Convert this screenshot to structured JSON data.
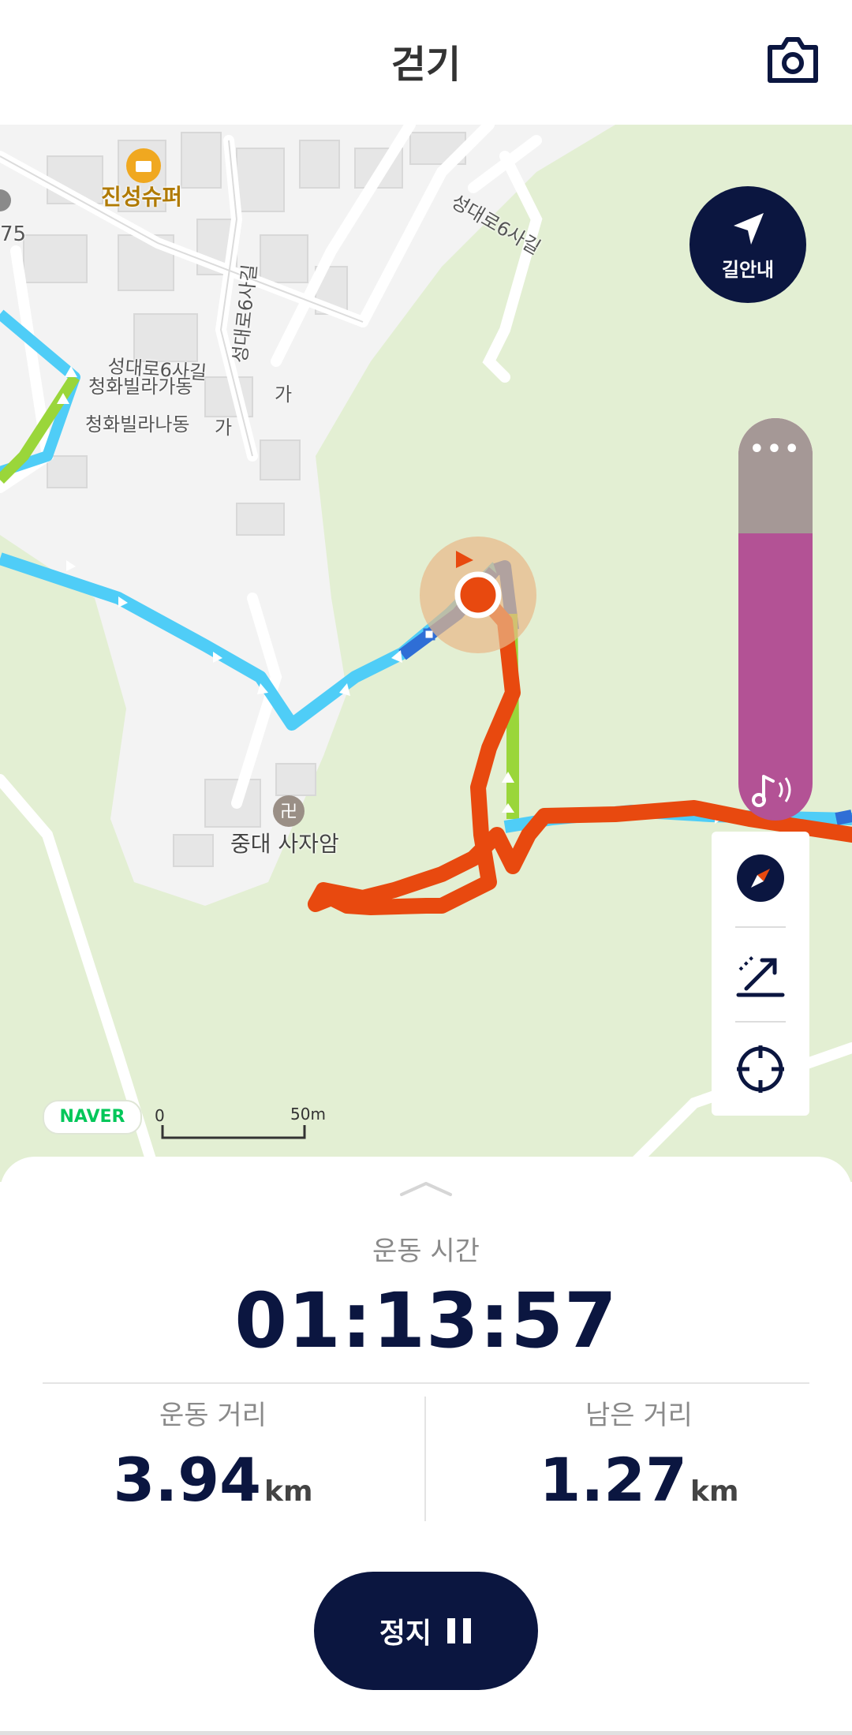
{
  "header": {
    "title": "걷기",
    "camera_icon": "camera-icon"
  },
  "map": {
    "labels": {
      "poi_store": "진성슈퍼",
      "edge_number": "75",
      "road_top": "성대로6사길",
      "road_vertical": "성대로6사길",
      "road_mid": "성대로6사길",
      "villa_ga": "청화빌라가동",
      "villa_na": "청화빌라나동",
      "ga_1": "가",
      "ga_2": "가",
      "temple": "중대 사자암"
    },
    "guide_button": {
      "label": "길안내",
      "icon": "navigation-arrow-icon"
    },
    "more_label": "•••",
    "naver_logo": "NAVER",
    "scale": {
      "zero": "0",
      "fifty": "50m"
    },
    "tools": [
      "compass-icon",
      "elevation-icon",
      "locate-icon"
    ],
    "colors": {
      "route_planned": "#4fcdf7",
      "route_walked": "#e8490f",
      "route_green": "#9ad63a",
      "slider": "#b35295"
    }
  },
  "sheet": {
    "time_label": "운동 시간",
    "time_value": "01:13:57",
    "distance_label": "운동 거리",
    "distance_value": "3.94",
    "distance_unit": "km",
    "remaining_label": "남은 거리",
    "remaining_value": "1.27",
    "remaining_unit": "km",
    "stop_label": "정지"
  }
}
